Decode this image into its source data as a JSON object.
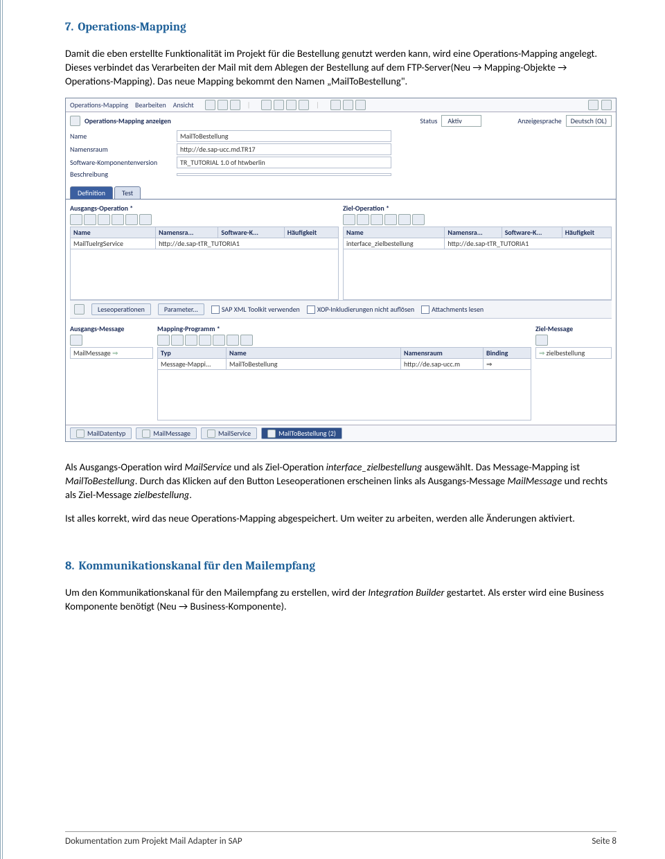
{
  "section7": {
    "num": "7.",
    "title": "Operations-Mapping",
    "p1": "Damit die eben erstellte Funktionalität im Projekt für die Bestellung genutzt werden kann, wird eine Operations-Mapping angelegt. Dieses verbindet das Verarbeiten der Mail mit dem Ablegen der Bestellung auf dem FTP-Server(Neu → Mapping-Objekte → Operations-Mapping). Das neue Mapping bekommt den Namen „MailToBestellung\".",
    "p2a": "Als Ausgangs-Operation wird ",
    "p2b": " und als Ziel-Operation ",
    "p2c": " ausgewählt. Das Message-Mapping ist ",
    "p2d": ". Durch das Klicken auf den Button Leseoperationen erscheinen links als Ausgangs-Message ",
    "p2e": " und rechts als Ziel-Message ",
    "p2f": ".",
    "ital1": "MailService",
    "ital2": "interface_zielbestellung",
    "ital3": "MailToBestellung",
    "ital4": "MailMessage",
    "ital5": "zielbestellung",
    "p3": "Ist alles korrekt, wird das neue Operations-Mapping abgespeichert. Um weiter zu arbeiten, werden alle Änderungen aktiviert."
  },
  "section8": {
    "num": "8.",
    "title": "Kommunikationskanal für den Mailempfang",
    "p1a": "Um den Kommunikationskanal für den Mailempfang zu erstellen, wird der ",
    "p1b": " gestartet. Als erster wird eine Business Komponente benötigt (Neu → Business-Komponente).",
    "ital1": "Integration Builder"
  },
  "app": {
    "menu": {
      "m1": "Operations-Mapping",
      "m2": "Bearbeiten",
      "m3": "Ansicht"
    },
    "hdr": {
      "title": "Operations-Mapping anzeigen",
      "statusLbl": "Status",
      "statusVal": "Aktiv",
      "langLbl": "Anzeigesprache",
      "langVal": "Deutsch (OL)"
    },
    "fields": {
      "l1": "Name",
      "v1": "MailToBestellung",
      "l2": "Namensraum",
      "v2": "http://de.sap-ucc.md.TR17",
      "l3": "Software-Komponentenversion",
      "v3": "TR_TUTORIAL 1.0 of htwberlin",
      "l4": "Beschreibung",
      "v4": ""
    },
    "tabs": {
      "t1": "Definition",
      "t2": "Test"
    },
    "cols": {
      "left": {
        "title": "Ausgangs-Operation *",
        "h1": "Name",
        "h2": "Namensra...",
        "h3": "Software-K...",
        "h4": "Häufigkeit",
        "r1": "MailTuelrgService",
        "r2": "http://de.sap-tTR_TUTORIA1"
      },
      "right": {
        "title": "Ziel-Operation *",
        "h1": "Name",
        "h2": "Namensra...",
        "h3": "Software-K...",
        "h4": "Häufigkeit",
        "r1": "interface_zielbestellung",
        "r2": "http://de.sap-tTR_TUTORIA1"
      }
    },
    "mid": {
      "b1": "Leseoperationen",
      "b2": "Parameter...",
      "c1": "SAP XML Toolkit verwenden",
      "c2": "XOP-Inkludierungen nicht auflösen",
      "c3": "Attachments lesen"
    },
    "three": {
      "a": {
        "title": "Ausgangs-Message",
        "val": "MailMessage"
      },
      "b": {
        "title": "Mapping-Programm *",
        "h1": "Typ",
        "h2": "Name",
        "h3": "Namensraum",
        "h4": "Binding",
        "r1": "Message-Mappi...",
        "r2": "MailToBestellung",
        "r3": "http://de.sap-ucc.m"
      },
      "c": {
        "title": "Ziel-Message",
        "val": "zielbestellung"
      }
    },
    "status": {
      "s1": "MailDatentyp",
      "s2": "MailMessage",
      "s3": "MailService",
      "s4": "MailToBestellung (2)"
    }
  },
  "footer": {
    "left": "Dokumentation zum Projekt Mail Adapter in SAP",
    "right": "Seite 8"
  }
}
